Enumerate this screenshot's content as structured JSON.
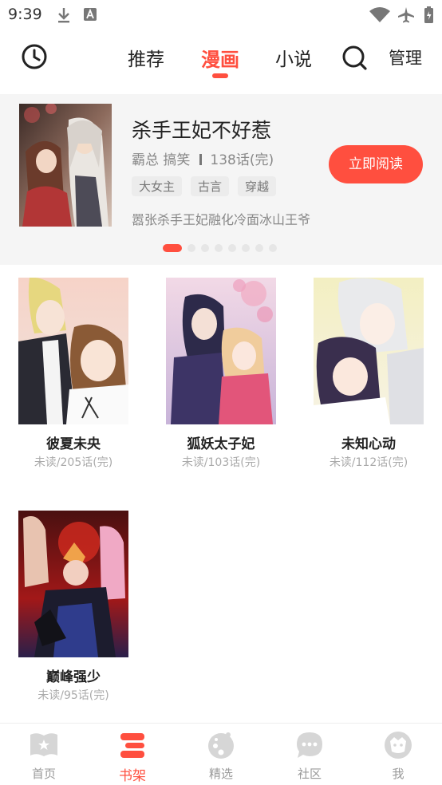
{
  "status_bar": {
    "time": "9:39",
    "icons": [
      "download-icon",
      "a-icon",
      "wifi-icon",
      "airplane-icon",
      "battery-icon"
    ]
  },
  "top_nav": {
    "tabs": [
      {
        "label": "推荐",
        "active": false
      },
      {
        "label": "漫画",
        "active": true
      },
      {
        "label": "小说",
        "active": false
      }
    ],
    "manage_label": "管理",
    "icons": [
      "history-icon",
      "search-icon"
    ]
  },
  "banner": {
    "title": "杀手王妃不好惹",
    "genres": "霸总 搞笑",
    "chapters": "138话(完)",
    "tags": [
      "大女主",
      "古言",
      "穿越"
    ],
    "description": "嚣张杀手王妃融化冷面冰山王爷",
    "read_button": "立即阅读",
    "page_count": 8,
    "active_page": 1
  },
  "shelf": {
    "books": [
      {
        "title": "彼夏未央",
        "progress": "未读/205话(完)"
      },
      {
        "title": "狐妖太子妃",
        "progress": "未读/103话(完)"
      },
      {
        "title": "未知心动",
        "progress": "未读/112话(完)"
      },
      {
        "title": "巅峰强少",
        "progress": "未读/95话(完)"
      }
    ]
  },
  "bottom_nav": {
    "items": [
      {
        "label": "首页",
        "icon": "home-book-icon",
        "active": false
      },
      {
        "label": "书架",
        "icon": "bookshelf-icon",
        "active": true
      },
      {
        "label": "精选",
        "icon": "featured-icon",
        "active": false
      },
      {
        "label": "社区",
        "icon": "community-icon",
        "active": false
      },
      {
        "label": "我",
        "icon": "profile-icon",
        "active": false
      }
    ]
  },
  "colors": {
    "accent": "#ff4f3f",
    "muted_text": "#999999",
    "banner_bg": "#f5f5f5"
  }
}
